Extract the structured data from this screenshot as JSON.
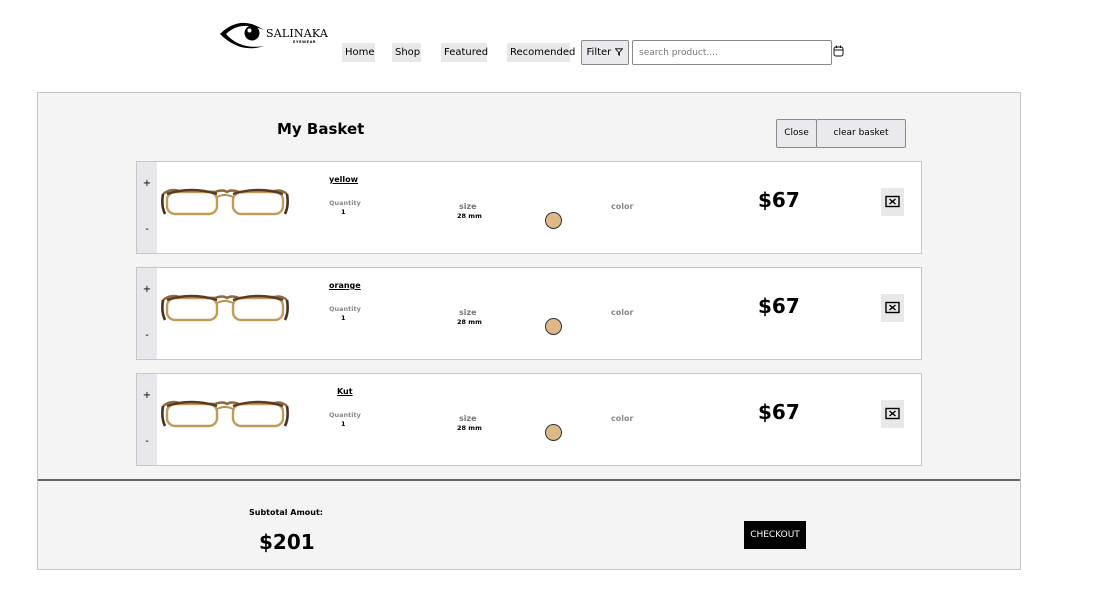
{
  "header": {
    "logo_text": "SALINAKA",
    "logo_subtext": "EYEWEAR",
    "nav": [
      "Home",
      "Shop",
      "Featured",
      "Recomended"
    ],
    "filter_label": "Filter",
    "filter_icon": "filter-funnel-icon",
    "search_placeholder": "search product....",
    "search_icon": "search-icon"
  },
  "basket": {
    "title": "My Basket",
    "close_label": "Close",
    "clear_label": "clear basket",
    "items": [
      {
        "name": "yellow",
        "quantity_label": "Quantity",
        "quantity": "1",
        "size_label": "size",
        "size": "28 mm",
        "color_label": "color",
        "swatch_color": "#deb887",
        "price": "$67"
      },
      {
        "name": "orange",
        "quantity_label": "Quantity",
        "quantity": "1",
        "size_label": "size",
        "size": "28 mm",
        "color_label": "color",
        "swatch_color": "#deb887",
        "price": "$67"
      },
      {
        "name": "Kut",
        "quantity_label": "Quantity",
        "quantity": "1",
        "size_label": "size",
        "size": "28 mm",
        "color_label": "color",
        "swatch_color": "#deb887",
        "price": "$67"
      }
    ],
    "plus_label": "+",
    "minus_label": "-",
    "subtotal_label": "Subtotal Amout:",
    "subtotal_value": "$201",
    "checkout_label": "CHECKOUT"
  }
}
